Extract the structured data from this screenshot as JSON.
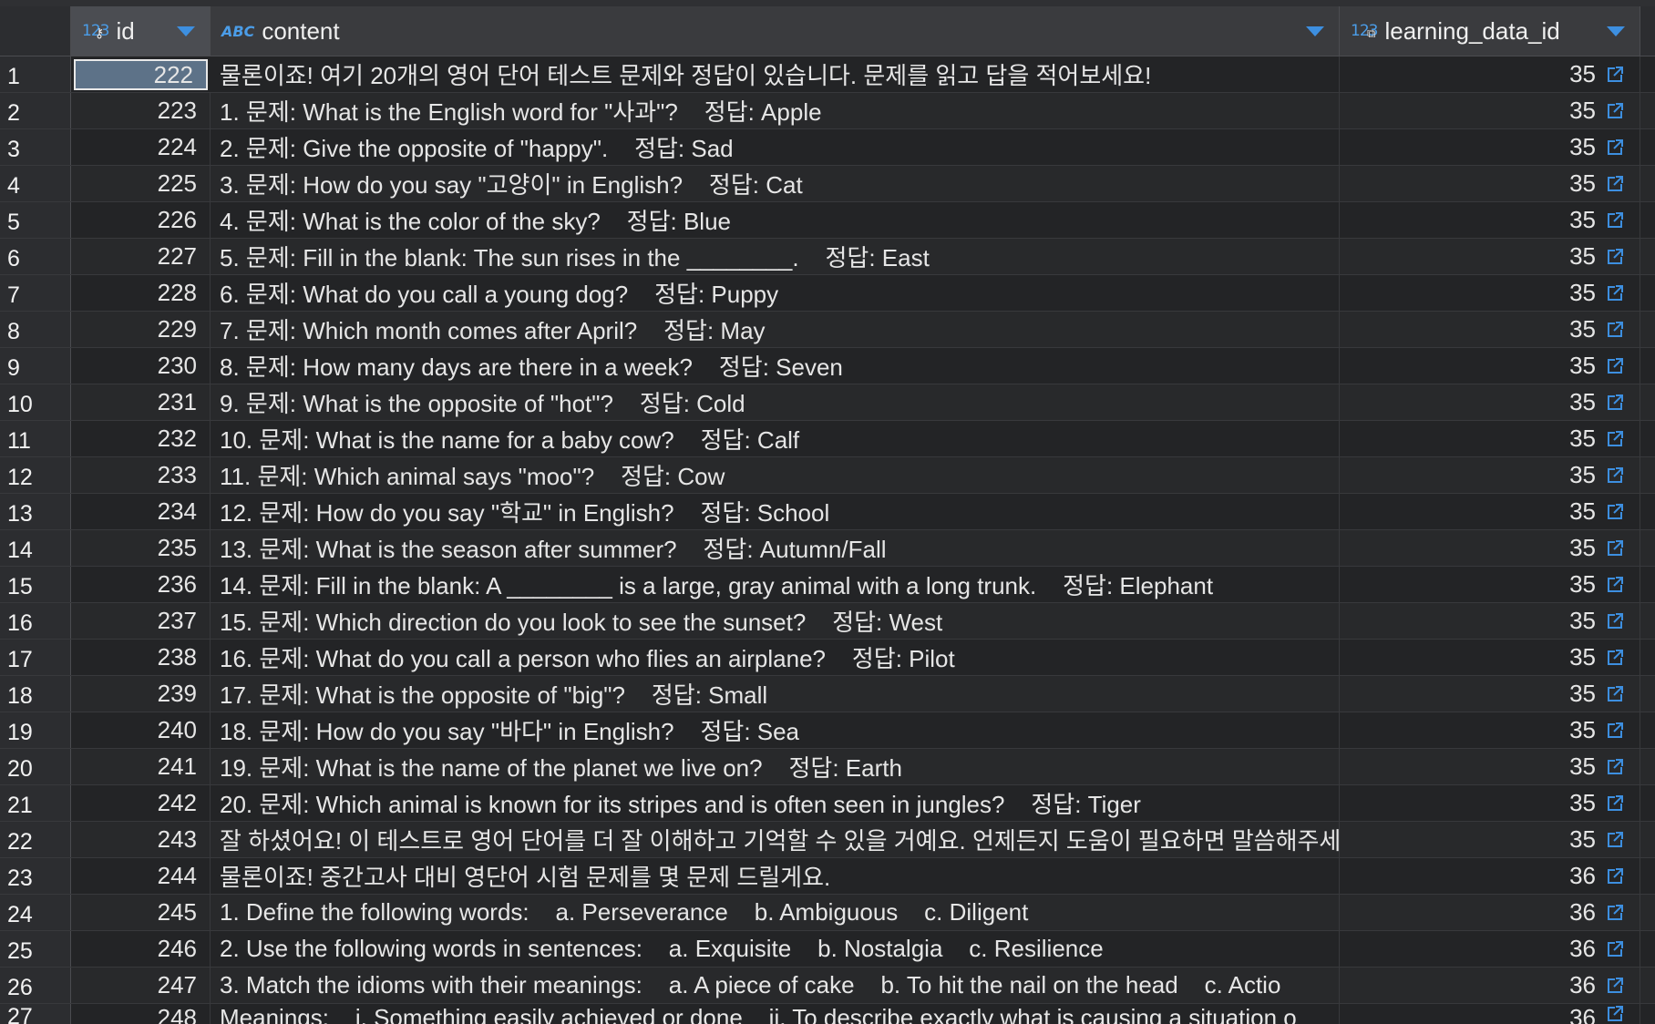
{
  "columns": {
    "id": {
      "type": "123",
      "label": "id"
    },
    "content": {
      "type": "ABC",
      "label": "content"
    },
    "learning_data_id": {
      "type": "123",
      "label": "learning_data_id"
    }
  },
  "rows": [
    {
      "n": "1",
      "id": "222",
      "content": "물론이죠! 여기 20개의 영어 단어 테스트 문제와 정답이 있습니다. 문제를 읽고 답을 적어보세요!",
      "ldid": "35"
    },
    {
      "n": "2",
      "id": "223",
      "content": "1. 문제: What is the English word for \"사과\"?    정답: Apple",
      "ldid": "35"
    },
    {
      "n": "3",
      "id": "224",
      "content": "2. 문제: Give the opposite of \"happy\".    정답: Sad",
      "ldid": "35"
    },
    {
      "n": "4",
      "id": "225",
      "content": "3. 문제: How do you say \"고양이\" in English?    정답: Cat",
      "ldid": "35"
    },
    {
      "n": "5",
      "id": "226",
      "content": "4. 문제: What is the color of the sky?    정답: Blue",
      "ldid": "35"
    },
    {
      "n": "6",
      "id": "227",
      "content": "5. 문제: Fill in the blank: The sun rises in the ________.    정답: East",
      "ldid": "35"
    },
    {
      "n": "7",
      "id": "228",
      "content": "6. 문제: What do you call a young dog?    정답: Puppy",
      "ldid": "35"
    },
    {
      "n": "8",
      "id": "229",
      "content": "7. 문제: Which month comes after April?    정답: May",
      "ldid": "35"
    },
    {
      "n": "9",
      "id": "230",
      "content": "8. 문제: How many days are there in a week?    정답: Seven",
      "ldid": "35"
    },
    {
      "n": "10",
      "id": "231",
      "content": "9. 문제: What is the opposite of \"hot\"?    정답: Cold",
      "ldid": "35"
    },
    {
      "n": "11",
      "id": "232",
      "content": "10. 문제: What is the name for a baby cow?    정답: Calf",
      "ldid": "35"
    },
    {
      "n": "12",
      "id": "233",
      "content": "11. 문제: Which animal says \"moo\"?    정답: Cow",
      "ldid": "35"
    },
    {
      "n": "13",
      "id": "234",
      "content": "12. 문제: How do you say \"학교\" in English?    정답: School",
      "ldid": "35"
    },
    {
      "n": "14",
      "id": "235",
      "content": "13. 문제: What is the season after summer?    정답: Autumn/Fall",
      "ldid": "35"
    },
    {
      "n": "15",
      "id": "236",
      "content": "14. 문제: Fill in the blank: A ________ is a large, gray animal with a long trunk.    정답: Elephant",
      "ldid": "35"
    },
    {
      "n": "16",
      "id": "237",
      "content": "15. 문제: Which direction do you look to see the sunset?    정답: West",
      "ldid": "35"
    },
    {
      "n": "17",
      "id": "238",
      "content": "16. 문제: What do you call a person who flies an airplane?    정답: Pilot",
      "ldid": "35"
    },
    {
      "n": "18",
      "id": "239",
      "content": "17. 문제: What is the opposite of \"big\"?    정답: Small",
      "ldid": "35"
    },
    {
      "n": "19",
      "id": "240",
      "content": "18. 문제: How do you say \"바다\" in English?    정답: Sea",
      "ldid": "35"
    },
    {
      "n": "20",
      "id": "241",
      "content": "19. 문제: What is the name of the planet we live on?    정답: Earth",
      "ldid": "35"
    },
    {
      "n": "21",
      "id": "242",
      "content": "20. 문제: Which animal is known for its stripes and is often seen in jungles?    정답: Tiger",
      "ldid": "35"
    },
    {
      "n": "22",
      "id": "243",
      "content": "잘 하셨어요! 이 테스트로 영어 단어를 더 잘 이해하고 기억할 수 있을 거예요. 언제든지 도움이 필요하면 말씀해주세요!",
      "ldid": "35"
    },
    {
      "n": "23",
      "id": "244",
      "content": "물론이죠! 중간고사 대비 영단어 시험 문제를 몇 문제 드릴게요.",
      "ldid": "36"
    },
    {
      "n": "24",
      "id": "245",
      "content": "1. Define the following words:    a. Perseverance    b. Ambiguous    c. Diligent",
      "ldid": "36"
    },
    {
      "n": "25",
      "id": "246",
      "content": "2. Use the following words in sentences:    a. Exquisite    b. Nostalgia    c. Resilience",
      "ldid": "36"
    },
    {
      "n": "26",
      "id": "247",
      "content": "3. Match the idioms with their meanings:    a. A piece of cake    b. To hit the nail on the head    c. Actio",
      "ldid": "36"
    },
    {
      "n": "27",
      "id": "248",
      "content": "Meanings:    i. Something easily achieved or done    ii. To describe exactly what is causing a situation o",
      "ldid": "36"
    }
  ],
  "colors": {
    "accent": "#3d8fe0",
    "selection": "#5d7288",
    "background": "#232426",
    "header": "#3a3b3e"
  }
}
